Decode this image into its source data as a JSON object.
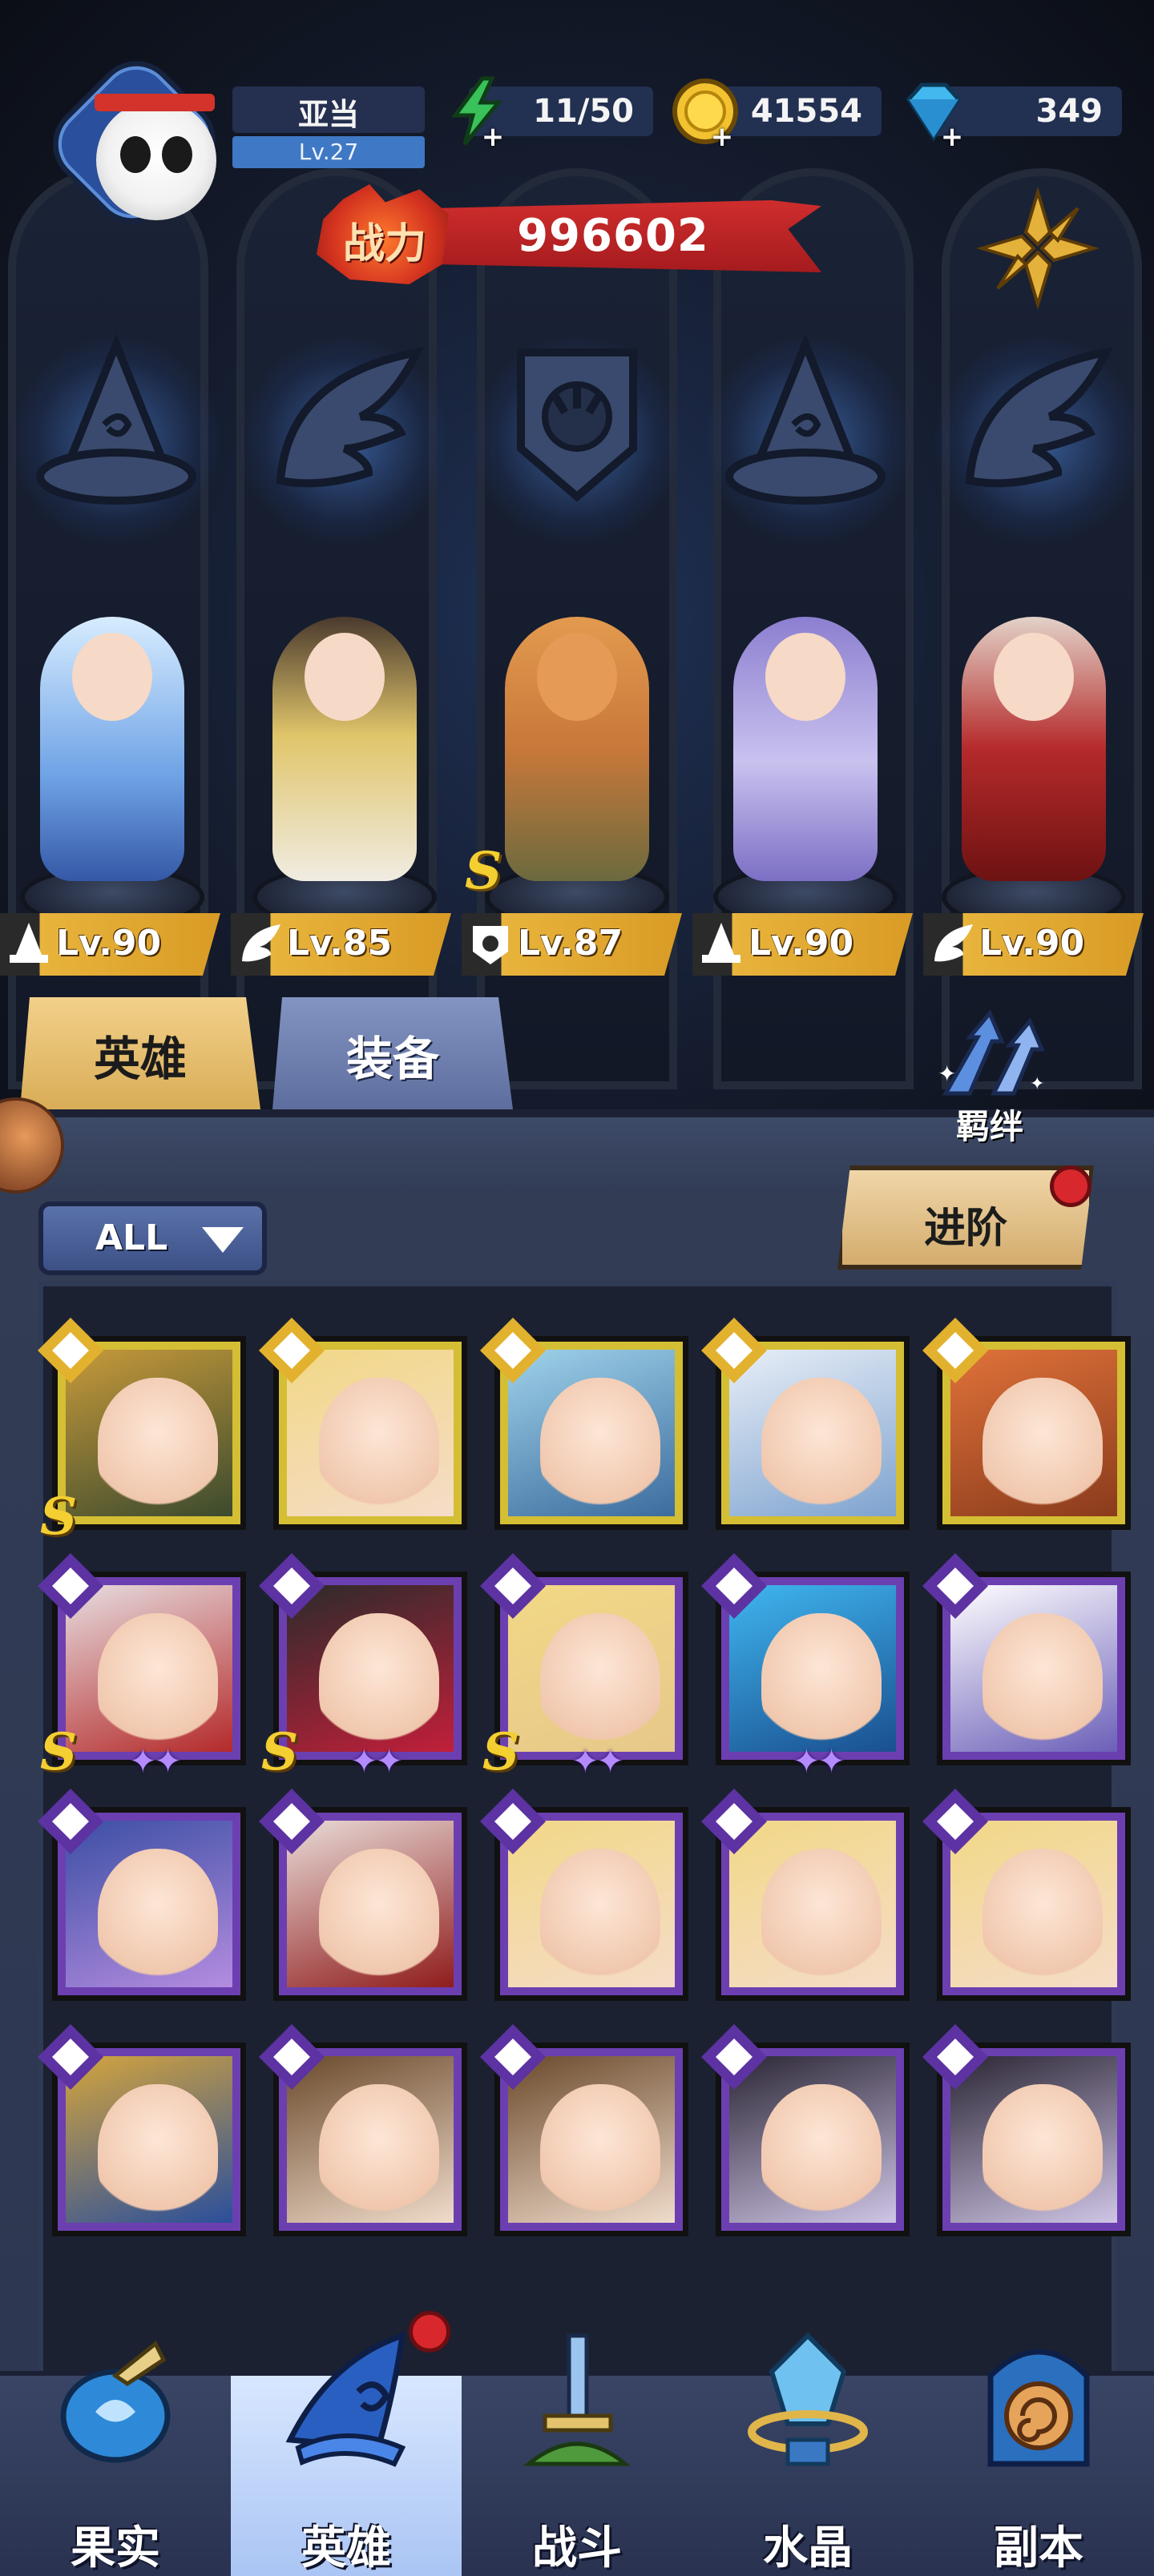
{
  "player": {
    "name": "亚当",
    "level": "Lv.27"
  },
  "resources": [
    {
      "name": "stamina",
      "value": "11/50",
      "icon": "lightning-icon",
      "color": "#39c15a"
    },
    {
      "name": "gold",
      "value": "41554",
      "icon": "gold-coin-icon",
      "color": "#f2c230"
    },
    {
      "name": "diamond",
      "value": "349",
      "icon": "diamond-icon",
      "color": "#42b8ef"
    }
  ],
  "power": {
    "label": "战力",
    "value": "996602"
  },
  "formation": {
    "class_emblems": [
      "mage-hat-icon",
      "wing-icon",
      "beast-claw-icon",
      "mage-hat-icon",
      "wing-icon"
    ],
    "heroes": [
      {
        "level": "Lv.90",
        "class_icon": "mage-hat-icon",
        "rank": ""
      },
      {
        "level": "Lv.85",
        "class_icon": "wing-icon",
        "rank": ""
      },
      {
        "level": "Lv.87",
        "class_icon": "beast-claw-icon",
        "rank": "S"
      },
      {
        "level": "Lv.90",
        "class_icon": "mage-hat-icon",
        "rank": ""
      },
      {
        "level": "Lv.90",
        "class_icon": "wing-icon",
        "rank": ""
      }
    ]
  },
  "tabs": {
    "heroes": "英雄",
    "equipment": "装备"
  },
  "bond": {
    "label": "羁绊"
  },
  "filter": {
    "label": "ALL"
  },
  "advance": {
    "label": "进阶"
  },
  "hero_grid": [
    {
      "frame": "gold",
      "class": "wrench-icon",
      "rank": "S",
      "stars": ""
    },
    {
      "frame": "gold",
      "class": "wing-icon",
      "rank": "",
      "stars": ""
    },
    {
      "frame": "gold",
      "class": "wrench-icon",
      "rank": "",
      "stars": ""
    },
    {
      "frame": "gold",
      "class": "beast-claw-icon",
      "rank": "",
      "stars": ""
    },
    {
      "frame": "gold",
      "class": "beast-claw-icon",
      "rank": "",
      "stars": ""
    },
    {
      "frame": "purple",
      "class": "mage-hat-icon",
      "rank": "S",
      "stars": "✦✦"
    },
    {
      "frame": "purple",
      "class": "mage-hat-icon",
      "rank": "S",
      "stars": "✦✦"
    },
    {
      "frame": "purple",
      "class": "wing-icon",
      "rank": "S",
      "stars": "✦✦"
    },
    {
      "frame": "purple",
      "class": "wrench-icon",
      "rank": "",
      "stars": "✦✦"
    },
    {
      "frame": "purple",
      "class": "mage-hat-icon",
      "rank": "",
      "stars": ""
    },
    {
      "frame": "purple",
      "class": "mage-hat-icon",
      "rank": "",
      "stars": ""
    },
    {
      "frame": "purple",
      "class": "wing-icon",
      "rank": "",
      "stars": ""
    },
    {
      "frame": "purple",
      "class": "wing-icon",
      "rank": "",
      "stars": ""
    },
    {
      "frame": "purple",
      "class": "wing-icon",
      "rank": "",
      "stars": ""
    },
    {
      "frame": "purple",
      "class": "wing-icon",
      "rank": "",
      "stars": ""
    },
    {
      "frame": "purple",
      "class": "wing-icon",
      "rank": "",
      "stars": ""
    },
    {
      "frame": "purple",
      "class": "wing-icon",
      "rank": "",
      "stars": ""
    },
    {
      "frame": "purple",
      "class": "wing-icon",
      "rank": "",
      "stars": ""
    },
    {
      "frame": "purple",
      "class": "wing-icon",
      "rank": "",
      "stars": ""
    },
    {
      "frame": "purple",
      "class": "wing-icon",
      "rank": "",
      "stars": ""
    }
  ],
  "bottom_nav": [
    {
      "label": "果实",
      "icon": "fruit-icon",
      "active": false
    },
    {
      "label": "英雄",
      "icon": "hero-hat-icon",
      "active": true
    },
    {
      "label": "战斗",
      "icon": "sword-icon",
      "active": false
    },
    {
      "label": "水晶",
      "icon": "crystal-icon",
      "active": false
    },
    {
      "label": "副本",
      "icon": "portal-icon",
      "active": false
    }
  ]
}
